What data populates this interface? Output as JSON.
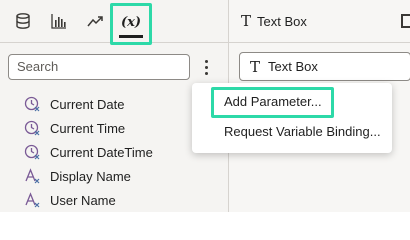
{
  "left_panel": {
    "tabs": [
      {
        "icon": "database-icon"
      },
      {
        "icon": "bar-chart-icon"
      },
      {
        "icon": "trend-line-icon"
      },
      {
        "icon": "variables-icon",
        "label": "(x)",
        "selected": true
      }
    ],
    "search": {
      "placeholder": "Search",
      "value": ""
    },
    "variables": [
      {
        "label": "Current Date",
        "icon": "clock-variable-icon"
      },
      {
        "label": "Current Time",
        "icon": "clock-variable-icon"
      },
      {
        "label": "Current DateTime",
        "icon": "clock-variable-icon"
      },
      {
        "label": "Display Name",
        "icon": "text-variable-icon"
      },
      {
        "label": "User Name",
        "icon": "text-variable-icon"
      }
    ]
  },
  "right_panel": {
    "header_title": "Text Box",
    "element_field": "Text Box"
  },
  "menu": {
    "add_parameter": "Add Parameter...",
    "request_binding": "Request Variable Binding..."
  },
  "colors": {
    "highlight": "#2dd9a8",
    "panel_bg": "#f5f4f2",
    "icon_purple": "#7a5a96",
    "icon_blue": "#4a6fa5"
  }
}
